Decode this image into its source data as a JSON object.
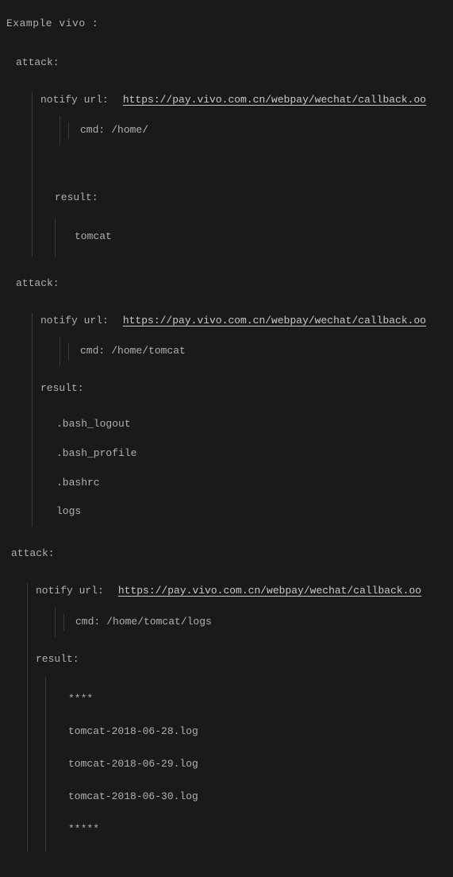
{
  "title": "Example  vivo :",
  "attacks": [
    {
      "label": "attack:",
      "notify_label": "notify url:",
      "notify_url": "https://pay.vivo.com.cn/webpay/wechat/callback.oo",
      "cmd_label": "cmd:",
      "cmd_value": "/home/",
      "result_label": "result:",
      "results": [
        "tomcat"
      ]
    },
    {
      "label": "attack:",
      "notify_label": "notify url:",
      "notify_url": "https://pay.vivo.com.cn/webpay/wechat/callback.oo",
      "cmd_label": "cmd:",
      "cmd_value": "/home/tomcat",
      "result_label": "result:",
      "results": [
        ".bash_logout",
        ".bash_profile",
        ".bashrc",
        "logs"
      ]
    },
    {
      "label": "attack:",
      "notify_label": "notify url:",
      "notify_url": "https://pay.vivo.com.cn/webpay/wechat/callback.oo",
      "cmd_label": "cmd:",
      "cmd_value": "/home/tomcat/logs",
      "result_label": "result:",
      "results": [
        "****",
        "tomcat-2018-06-28.log",
        "tomcat-2018-06-29.log",
        "tomcat-2018-06-30.log",
        "*****"
      ]
    }
  ]
}
